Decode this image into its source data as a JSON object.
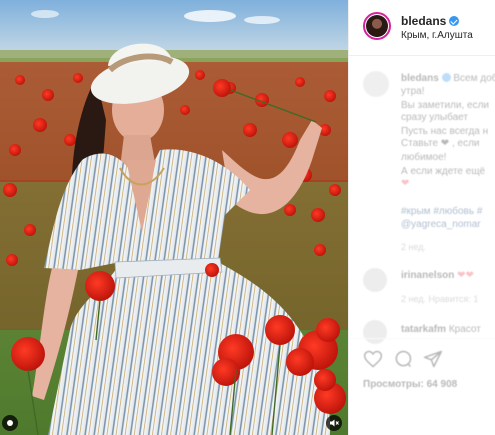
{
  "post": {
    "header": {
      "username": "bledans",
      "location": "Крым, г.Алушта",
      "avatar_icon": "profile-avatar",
      "verified_icon": "verified-badge-icon"
    },
    "caption": {
      "username": "bledans",
      "lines": [
        "Всем доб",
        "утра!",
        "Вы заметили, если",
        "сразу улыбает",
        "Пусть нас всегда н",
        "Ставьте ❤ , если",
        "любимое!",
        "А если ждете ещё"
      ],
      "hashtags": "#крым #любовь #",
      "mention": "@yagreca_nomar",
      "time_ago": "2 нед."
    },
    "comments": [
      {
        "username": "irinanelson",
        "text": "❤❤"
      },
      {
        "username": "tatarkafm",
        "text": "Красот"
      }
    ],
    "comment_reply": "2 нед.   Нравится: 1",
    "views": "Просмотры: 64 908",
    "media_colors": {
      "sky": "#8fb6d8",
      "poppy": "#d91a12",
      "grass": "#5f8a3a"
    }
  }
}
